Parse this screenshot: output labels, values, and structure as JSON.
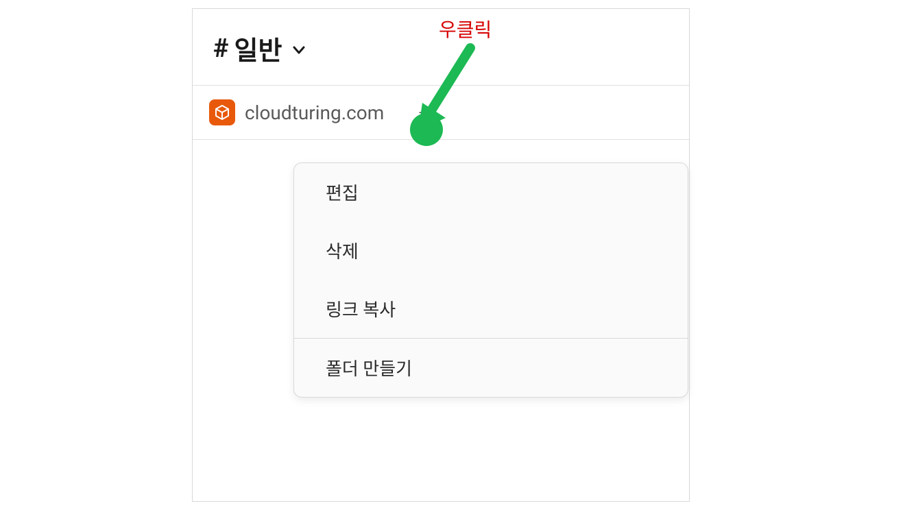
{
  "header": {
    "hash": "#",
    "title": "일반"
  },
  "bookmark": {
    "label": "cloudturing.com",
    "plus": "+"
  },
  "context_menu": {
    "items": [
      "편집",
      "삭제",
      "링크 복사",
      "폴더 만들기"
    ]
  },
  "annotation": {
    "label": "우클릭"
  },
  "colors": {
    "accent_orange": "#e8590c",
    "annotation_red": "#d60000",
    "annotation_green": "#1db954"
  }
}
